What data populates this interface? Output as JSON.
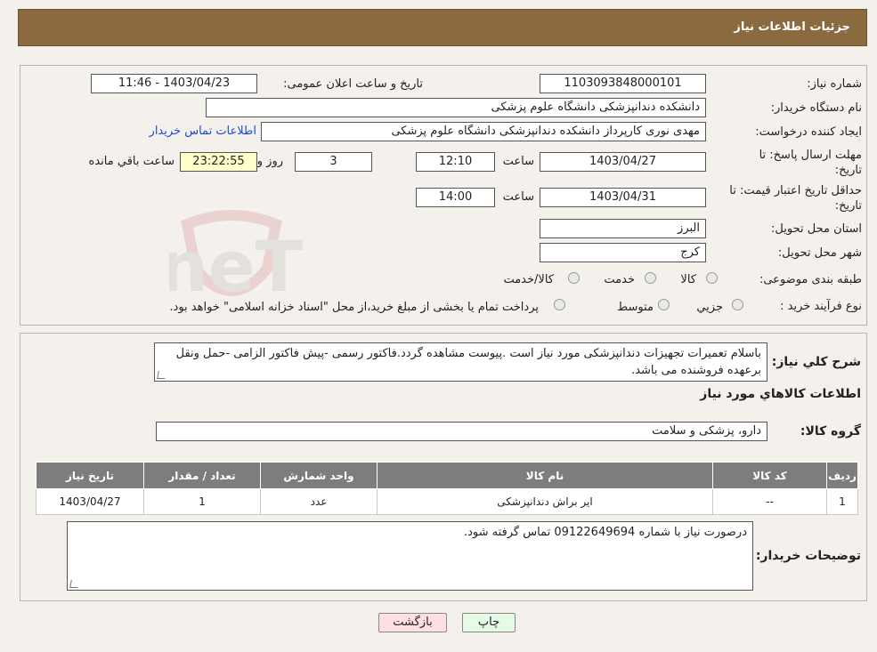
{
  "header": {
    "title": "جزئیات اطلاعات نیاز"
  },
  "watermark": {
    "text": "AriaTender.neT"
  },
  "form": {
    "need_number_label": "شماره نیاز:",
    "need_number": "1103093848000101",
    "announce_label": "تاریخ و ساعت اعلان عمومی:",
    "announce_value": "1403/04/23 - 11:46",
    "buyer_org_label": "نام دستگاه خریدار:",
    "buyer_org": "دانشکده دندانپزشکی دانشگاه علوم پزشکی",
    "creator_label": "ایجاد کننده درخواست:",
    "creator": "مهدی نوری کارپرداز دانشکده دندانپزشکی دانشگاه علوم پزشکی",
    "contact_link": "اطلاعات تماس خریدار",
    "deadline_label_1": "مهلت ارسال پاسخ: تا",
    "deadline_label_2": "تاریخ:",
    "deadline_date": "1403/04/27",
    "time_label": "ساعت",
    "deadline_time": "12:10",
    "days_value": "3",
    "days_label": "روز و",
    "remaining_time": "23:22:55",
    "remaining_label": "ساعت باقي مانده",
    "validity_label_1": "حداقل تاریخ اعتبار قیمت: تا",
    "validity_label_2": "تاریخ:",
    "validity_date": "1403/04/31",
    "validity_time": "14:00",
    "province_label": "استان محل تحویل:",
    "province": "البرز",
    "city_label": "شهر محل تحویل:",
    "city": "کرج",
    "category_label": "طبقه بندی موضوعی:",
    "category_options": [
      "کالا",
      "خدمت",
      "کالا/خدمت"
    ],
    "process_label": "نوع فرآیند خرید :",
    "process_options": [
      "جزیي",
      "متوسط"
    ],
    "process_note": "پرداخت تمام یا بخشی از مبلغ خرید،از محل \"اسناد خزانه اسلامی\" خواهد بود."
  },
  "description": {
    "label": "شرح کلي نیاز:",
    "text": "باسلام تعمیرات تجهیزات دندانپزشکی مورد نیاز است .پیوست مشاهده گردد.فاکتور رسمی -پیش فاکتور الزامی -حمل ونقل برعهده فروشنده می باشد."
  },
  "goods": {
    "section_title": "اطلاعات کالاهاي مورد نیاز",
    "group_label": "گروه کالا:",
    "group_value": "دارو، پزشکی و سلامت",
    "columns": [
      "ردیف",
      "کد کالا",
      "نام کالا",
      "واحد شمارش",
      "تعداد / مقدار",
      "تاریخ نیاز"
    ],
    "rows": [
      [
        "1",
        "--",
        "ایر براش دندانپزشکی",
        "عدد",
        "1",
        "1403/04/27"
      ]
    ]
  },
  "buyer_notes": {
    "label": "توضیحات خریدار:",
    "text": "درصورت نیاز با شماره 09122649694 تماس گرفته شود."
  },
  "buttons": {
    "print": "چاپ",
    "back": "بازگشت"
  },
  "colors": {
    "header_bg": "#8a6a3e",
    "table_header_bg": "#7d7d7d",
    "back_button_bg": "#ffe0e0",
    "print_button_bg": "#e6fbe6",
    "remaining_bg": "#ffffcc"
  }
}
